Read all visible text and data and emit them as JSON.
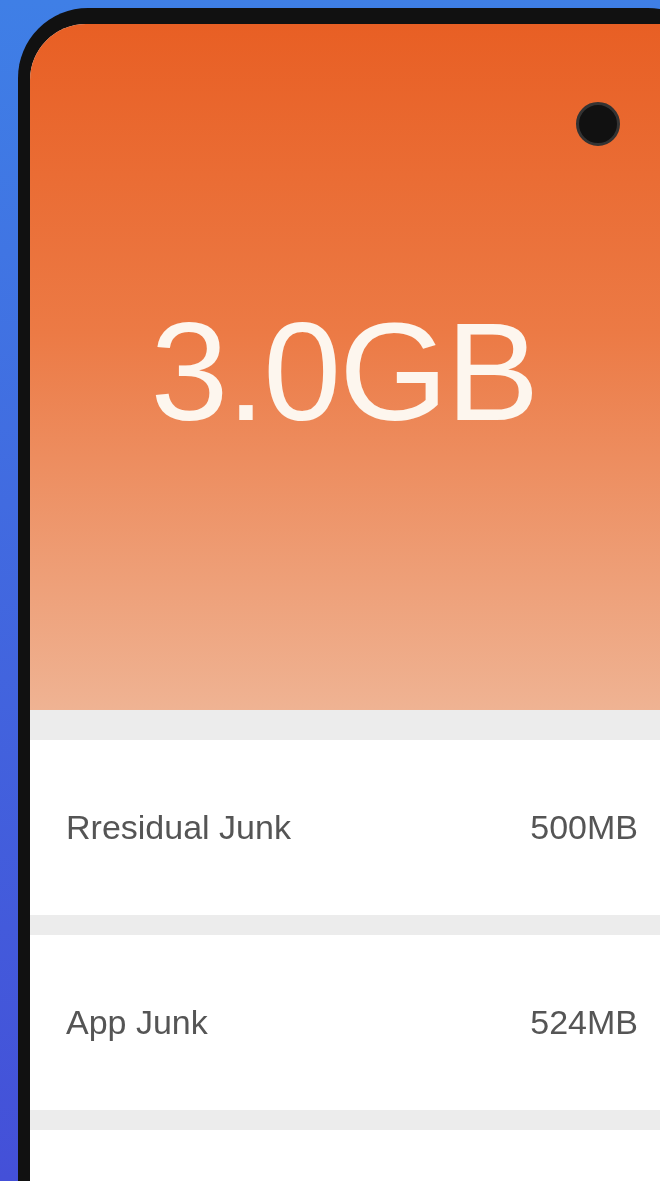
{
  "screen": {
    "total_size": "3.0GB",
    "items": [
      {
        "label": "Rresidual Junk",
        "size": "500MB"
      },
      {
        "label": "App Junk",
        "size": "524MB"
      }
    ]
  }
}
